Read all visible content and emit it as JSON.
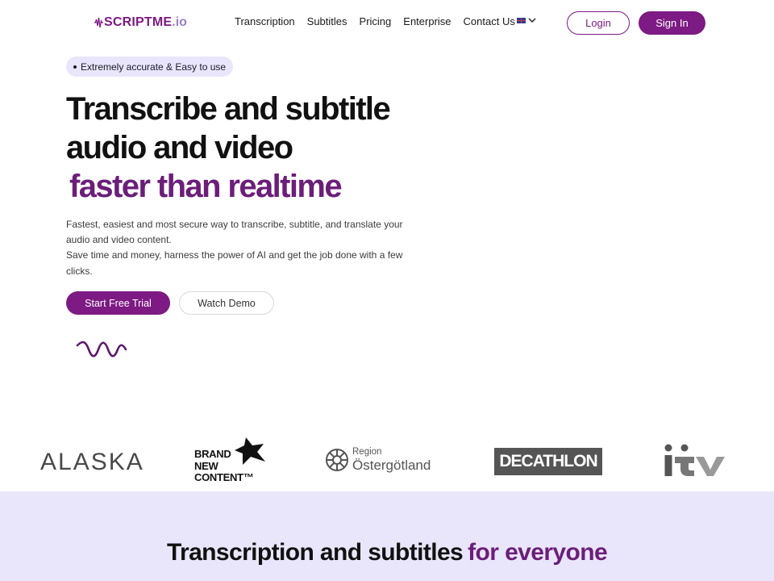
{
  "brand": {
    "logo_main": "SCRIPTME",
    "logo_suffix": ".io",
    "accent_color": "#7d1a83",
    "accent_text_color": "#6b1e79",
    "band_color": "#e9e6fb"
  },
  "nav": {
    "items": [
      {
        "label": "Transcription"
      },
      {
        "label": "Subtitles"
      },
      {
        "label": "Pricing"
      },
      {
        "label": "Enterprise"
      },
      {
        "label": "Contact Us"
      }
    ],
    "language_icon": "uk-flag-icon",
    "login_label": "Login",
    "signin_label": "Sign In"
  },
  "hero": {
    "badge": "Extremely accurate & Easy to use",
    "title_line1": "Transcribe and subtitle",
    "title_line2": "audio and video",
    "title_accent": "faster than realtime",
    "description_line1": "Fastest, easiest and most secure way to transcribe, subtitle, and translate your audio and video content.",
    "description_line2": "Save time and money, harness the power of AI and get the job done with a few clicks.",
    "primary_cta": "Start Free Trial",
    "secondary_cta": "Watch Demo"
  },
  "customer_logos": {
    "alaska": "ALASKA",
    "brand_new_content": [
      "BRAND",
      "NEW",
      "CONTENT™"
    ],
    "region_small": "Region",
    "region_big": "Östergötland",
    "decathlon": "DECATHLON",
    "itv": "itv"
  },
  "section": {
    "title": "Transcription and subtitles",
    "title_accent": "for everyone"
  }
}
